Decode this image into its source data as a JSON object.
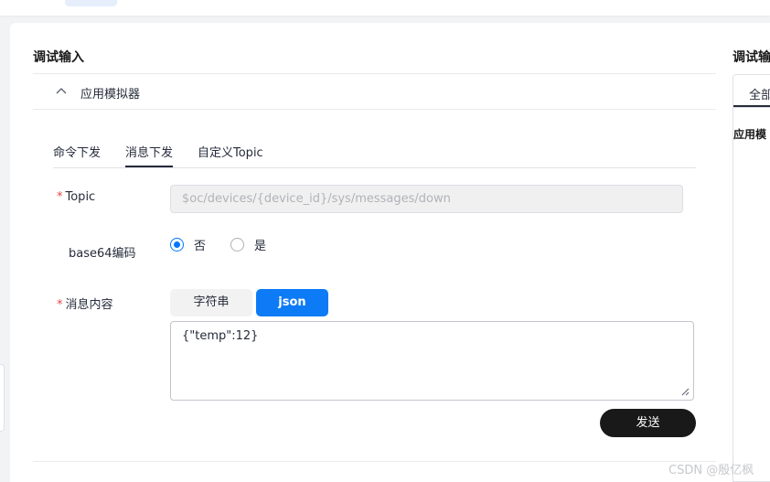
{
  "debug_input": {
    "title": "调试输入",
    "collapse_label": "应用模拟器",
    "tabs": [
      {
        "label": "命令下发",
        "active": false
      },
      {
        "label": "消息下发",
        "active": true
      },
      {
        "label": "自定义Topic",
        "active": false
      }
    ],
    "form": {
      "topic": {
        "label": "Topic",
        "required_mark": "*",
        "placeholder": "$oc/devices/{device_id}/sys/messages/down"
      },
      "base64": {
        "label": "base64编码",
        "options": [
          {
            "label": "否",
            "checked": true
          },
          {
            "label": "是",
            "checked": false
          }
        ]
      },
      "content": {
        "label": "消息内容",
        "required_mark": "*",
        "formats": [
          {
            "label": "字符串",
            "selected": false
          },
          {
            "label": "json",
            "selected": true
          }
        ],
        "value": "{\"temp\":12}"
      }
    },
    "send_label": "发送"
  },
  "debug_output": {
    "title": "调试输",
    "tab_label": "全部",
    "section_label": "应用模"
  },
  "watermark": "CSDN @殷亿枫",
  "colors": {
    "accent": "#0e7bf6",
    "required": "#e54545",
    "send_button": "#191919"
  }
}
